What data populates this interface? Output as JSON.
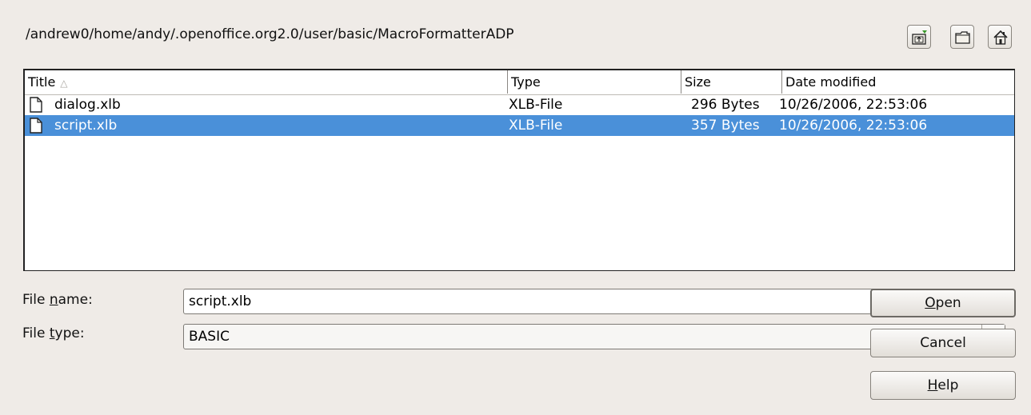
{
  "dialog": {
    "path": "/andrew0/home/andy/.openoffice.org2.0/user/basic/MacroFormatterADP"
  },
  "toolbar": {
    "up_icon": "folder-up-icon",
    "new_folder_icon": "new-folder-icon",
    "home_icon": "home-icon"
  },
  "list": {
    "columns": [
      {
        "label": "Title",
        "sort": "ascending"
      },
      {
        "label": "Type"
      },
      {
        "label": "Size"
      },
      {
        "label": "Date modified"
      }
    ],
    "rows": [
      {
        "name": "dialog.xlb",
        "type": "XLB-File",
        "size": "296 Bytes",
        "modified": "10/26/2006, 22:53:06",
        "selected": false
      },
      {
        "name": "script.xlb",
        "type": "XLB-File",
        "size": "357 Bytes",
        "modified": "10/26/2006, 22:53:06",
        "selected": true
      }
    ]
  },
  "form": {
    "file_name_label_pre": "File ",
    "file_name_label_mnemonic": "n",
    "file_name_label_post": "ame:",
    "file_name_value": "script.xlb",
    "file_type_label_pre": "File ",
    "file_type_label_mnemonic": "t",
    "file_type_label_post": "ype:",
    "file_type_value": "BASIC"
  },
  "buttons": {
    "open_mnemonic": "O",
    "open_rest": "pen",
    "cancel": "Cancel",
    "help_mnemonic": "H",
    "help_rest": "elp"
  },
  "colors": {
    "selection": "#4a90d9",
    "dialog_bg": "#efebe7"
  }
}
